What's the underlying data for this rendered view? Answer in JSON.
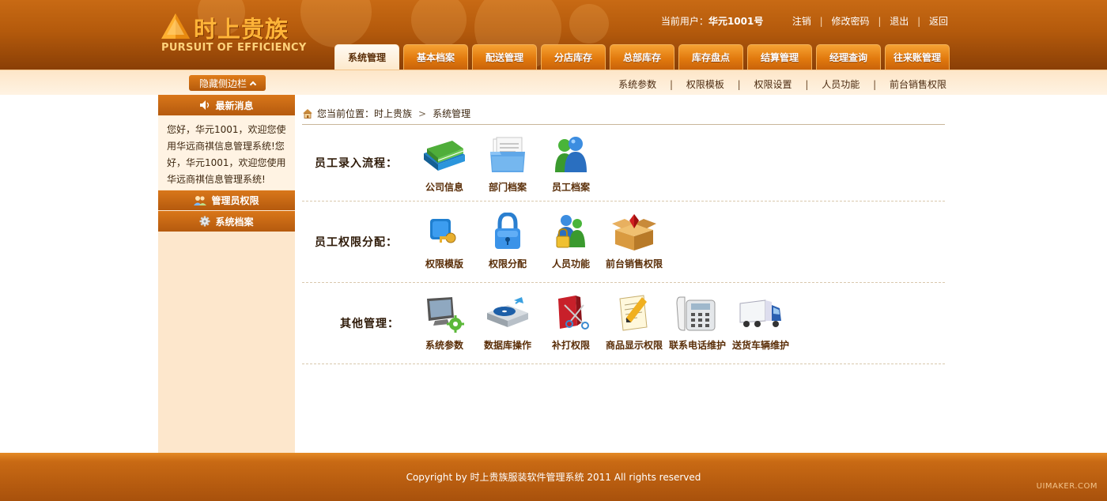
{
  "header": {
    "logo_cn": "时上贵族",
    "logo_en": "PURSUIT OF EFFICIENCY",
    "user_prefix": "当前用户：",
    "user_name": "华元1001号",
    "links": [
      "注销",
      "修改密码",
      "退出",
      "返回"
    ],
    "tabs": [
      "系统管理",
      "基本档案",
      "配送管理",
      "分店库存",
      "总部库存",
      "库存盘点",
      "结算管理",
      "经理查询",
      "往来账管理"
    ],
    "active_tab": 0
  },
  "subbar": {
    "hide_label": "隐藏侧边栏",
    "links": [
      "系统参数",
      "权限模板",
      "权限设置",
      "人员功能",
      "前台销售权限"
    ]
  },
  "sidebar": {
    "news_title": "最新消息",
    "news_text": "您好，华元1001，欢迎您使用华远商祺信息管理系统!您好，华元1001，欢迎您使用华远商祺信息管理系统!",
    "sections": [
      {
        "label": "管理员权限",
        "icon": "users-icon"
      },
      {
        "label": "系统档案",
        "icon": "gear-icon"
      }
    ]
  },
  "breadcrumb": {
    "prefix": "您当前位置：",
    "items": [
      "时上贵族",
      "系统管理"
    ]
  },
  "sections": [
    {
      "title": "员工录入流程：",
      "items": [
        {
          "label": "公司信息",
          "icon": "books-icon"
        },
        {
          "label": "部门档案",
          "icon": "folder-icon"
        },
        {
          "label": "员工档案",
          "icon": "person-icon"
        }
      ]
    },
    {
      "title": "员工权限分配：",
      "items": [
        {
          "label": "权限模版",
          "icon": "key-icon"
        },
        {
          "label": "权限分配",
          "icon": "lock-icon"
        },
        {
          "label": "人员功能",
          "icon": "people-lock-icon"
        },
        {
          "label": "前台销售权限",
          "icon": "gift-box-icon"
        }
      ]
    },
    {
      "title": "其他管理：",
      "items": [
        {
          "label": "系统参数",
          "icon": "monitor-gear-icon"
        },
        {
          "label": "数据库操作",
          "icon": "disc-drive-icon"
        },
        {
          "label": "补打权限",
          "icon": "scissors-icon"
        },
        {
          "label": "商品显示权限",
          "icon": "notepad-pencil-icon"
        },
        {
          "label": "联系电话维护",
          "icon": "telephone-icon"
        },
        {
          "label": "送货车辆维护",
          "icon": "truck-icon"
        }
      ]
    }
  ],
  "footer": {
    "copyright": "Copyright by 时上贵族服装软件管理系统 2011 All rights reserved",
    "watermark": "UIMAKER.COM"
  },
  "colors": {
    "brand_orange": "#c86a14",
    "tab_orange": "#e27a0e",
    "sidebar_bg": "#fde7cc",
    "text_brown": "#5a2e08"
  }
}
